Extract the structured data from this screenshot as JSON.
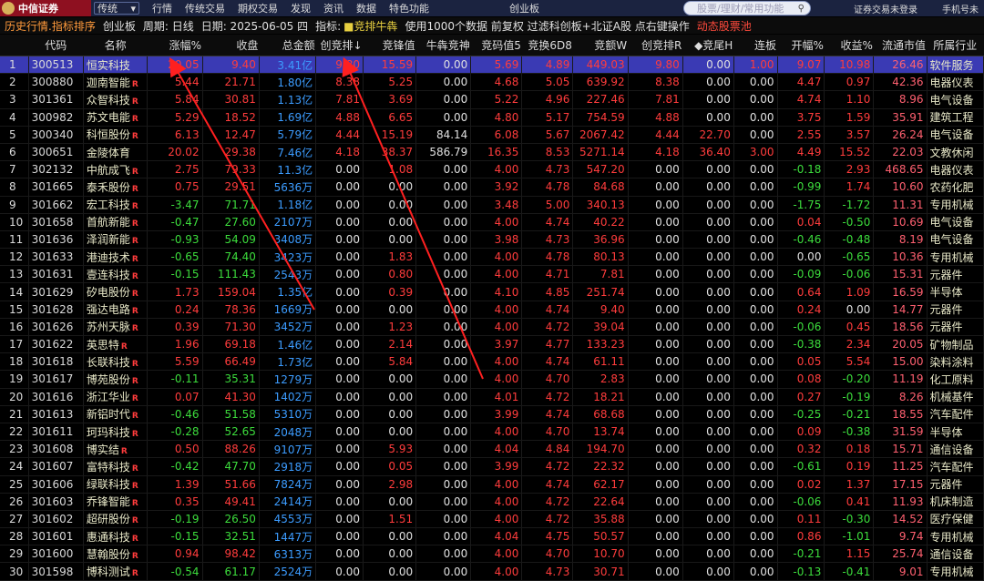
{
  "topbar": {
    "logo_text": "中信证券",
    "mode_select": "传统",
    "menu": [
      "行情",
      "传统交易",
      "期权交易",
      "发现",
      "资讯",
      "数据",
      "特色功能"
    ],
    "board_label": "创业板",
    "search_placeholder": "股票/理财/常用功能",
    "login_text": "证券交易未登录",
    "phone_text": "手机号未"
  },
  "infobar": {
    "history": "历史行情.指标排序",
    "board": "创业板",
    "period": "周期: 日线",
    "date": "日期: 2025-06-05 四",
    "indicator_label": "指标:",
    "indicator": "■竞排牛犇",
    "note": "使用1000个数据 前复权 过滤科创板+北证A股 点右键操作",
    "pool": "动态股票池"
  },
  "columns": [
    "",
    "代码",
    "名称",
    "涨幅%",
    "收盘",
    "总金额",
    "创竞排↓",
    "竞锋值",
    "牛犇竞神",
    "竞码值5",
    "竞换6D8",
    "竞额W",
    "创竞排R",
    "◆竞尾H",
    "连板",
    "开幅%",
    "收益%",
    "流通市值",
    "所属行业"
  ],
  "rows": [
    [
      "1",
      "300513",
      "恒实科技",
      "",
      "20.05",
      "9.40",
      "3.41亿",
      "9.80",
      "15.59",
      "0.00",
      "5.69",
      "4.89",
      "449.03",
      "9.80",
      "0.00",
      "1.00",
      "9.07",
      "10.98",
      "26.46",
      "软件服务"
    ],
    [
      "2",
      "300880",
      "迦南智能",
      "R",
      "5.44",
      "21.71",
      "1.80亿",
      "8.38",
      "5.25",
      "0.00",
      "4.68",
      "5.05",
      "639.92",
      "8.38",
      "0.00",
      "0.00",
      "4.47",
      "0.97",
      "42.36",
      "电器仪表"
    ],
    [
      "3",
      "301361",
      "众智科技",
      "R",
      "5.84",
      "30.81",
      "1.13亿",
      "7.81",
      "3.69",
      "0.00",
      "5.22",
      "4.96",
      "227.46",
      "7.81",
      "0.00",
      "0.00",
      "4.74",
      "1.10",
      "8.96",
      "电气设备"
    ],
    [
      "4",
      "300982",
      "苏文电能",
      "R",
      "5.29",
      "18.52",
      "1.69亿",
      "4.88",
      "6.65",
      "0.00",
      "4.80",
      "5.17",
      "754.59",
      "4.88",
      "0.00",
      "0.00",
      "3.75",
      "1.59",
      "35.91",
      "建筑工程"
    ],
    [
      "5",
      "300340",
      "科恒股份",
      "R",
      "6.13",
      "12.47",
      "5.79亿",
      "4.44",
      "15.19",
      "84.14",
      "6.08",
      "5.67",
      "2067.42",
      "4.44",
      "22.70",
      "0.00",
      "2.55",
      "3.57",
      "26.24",
      "电气设备"
    ],
    [
      "6",
      "300651",
      "金陵体育",
      "",
      "20.02",
      "29.38",
      "7.46亿",
      "4.18",
      "38.37",
      "586.79",
      "16.35",
      "8.53",
      "5271.14",
      "4.18",
      "36.40",
      "3.00",
      "4.49",
      "15.52",
      "22.03",
      "文教休闲"
    ],
    [
      "7",
      "302132",
      "中航成飞",
      "R",
      "2.75",
      "79.33",
      "11.3亿",
      "0.00",
      "1.08",
      "0.00",
      "4.00",
      "4.73",
      "547.20",
      "0.00",
      "0.00",
      "0.00",
      "-0.18",
      "2.93",
      "468.65",
      "电器仪表"
    ],
    [
      "8",
      "301665",
      "泰禾股份",
      "R",
      "0.75",
      "29.51",
      "5636万",
      "0.00",
      "0.00",
      "0.00",
      "3.92",
      "4.78",
      "84.68",
      "0.00",
      "0.00",
      "0.00",
      "-0.99",
      "1.74",
      "10.60",
      "农药化肥"
    ],
    [
      "9",
      "301662",
      "宏工科技",
      "R",
      "-3.47",
      "71.71",
      "1.18亿",
      "0.00",
      "0.00",
      "0.00",
      "3.48",
      "5.00",
      "340.13",
      "0.00",
      "0.00",
      "0.00",
      "-1.75",
      "-1.72",
      "11.31",
      "专用机械"
    ],
    [
      "10",
      "301658",
      "首航新能",
      "R",
      "-0.47",
      "27.60",
      "2107万",
      "0.00",
      "0.00",
      "0.00",
      "4.00",
      "4.74",
      "40.22",
      "0.00",
      "0.00",
      "0.00",
      "0.04",
      "-0.50",
      "10.69",
      "电气设备"
    ],
    [
      "11",
      "301636",
      "泽润新能",
      "R",
      "-0.93",
      "54.09",
      "3408万",
      "0.00",
      "0.00",
      "0.00",
      "3.98",
      "4.73",
      "36.96",
      "0.00",
      "0.00",
      "0.00",
      "-0.46",
      "-0.48",
      "8.19",
      "电气设备"
    ],
    [
      "12",
      "301633",
      "港迪技术",
      "R",
      "-0.65",
      "74.40",
      "3423万",
      "0.00",
      "1.83",
      "0.00",
      "4.00",
      "4.78",
      "80.13",
      "0.00",
      "0.00",
      "0.00",
      "0.00",
      "-0.65",
      "10.36",
      "专用机械"
    ],
    [
      "13",
      "301631",
      "壹连科技",
      "R",
      "-0.15",
      "111.43",
      "2543万",
      "0.00",
      "0.80",
      "0.00",
      "4.00",
      "4.71",
      "7.81",
      "0.00",
      "0.00",
      "0.00",
      "-0.09",
      "-0.06",
      "15.31",
      "元器件"
    ],
    [
      "14",
      "301629",
      "矽电股份",
      "R",
      "1.73",
      "159.04",
      "1.35亿",
      "0.00",
      "0.39",
      "0.00",
      "4.10",
      "4.85",
      "251.74",
      "0.00",
      "0.00",
      "0.00",
      "0.64",
      "1.09",
      "16.59",
      "半导体"
    ],
    [
      "15",
      "301628",
      "强达电路",
      "R",
      "0.24",
      "78.36",
      "1669万",
      "0.00",
      "0.00",
      "0.00",
      "4.00",
      "4.74",
      "9.40",
      "0.00",
      "0.00",
      "0.00",
      "0.24",
      "0.00",
      "14.77",
      "元器件"
    ],
    [
      "16",
      "301626",
      "苏州天脉",
      "R",
      "0.39",
      "71.30",
      "3452万",
      "0.00",
      "1.23",
      "0.00",
      "4.00",
      "4.72",
      "39.04",
      "0.00",
      "0.00",
      "0.00",
      "-0.06",
      "0.45",
      "18.56",
      "元器件"
    ],
    [
      "17",
      "301622",
      "英思特",
      "R",
      "1.96",
      "69.18",
      "1.46亿",
      "0.00",
      "2.14",
      "0.00",
      "3.97",
      "4.77",
      "133.23",
      "0.00",
      "0.00",
      "0.00",
      "-0.38",
      "2.34",
      "20.05",
      "矿物制品"
    ],
    [
      "18",
      "301618",
      "长联科技",
      "R",
      "5.59",
      "66.49",
      "1.73亿",
      "0.00",
      "5.84",
      "0.00",
      "4.00",
      "4.74",
      "61.11",
      "0.00",
      "0.00",
      "0.00",
      "0.05",
      "5.54",
      "15.00",
      "染料涂料"
    ],
    [
      "19",
      "301617",
      "博苑股份",
      "R",
      "-0.11",
      "35.31",
      "1279万",
      "0.00",
      "0.00",
      "0.00",
      "4.00",
      "4.70",
      "2.83",
      "0.00",
      "0.00",
      "0.00",
      "0.08",
      "-0.20",
      "11.19",
      "化工原料"
    ],
    [
      "20",
      "301616",
      "浙江华业",
      "R",
      "0.07",
      "41.30",
      "1402万",
      "0.00",
      "0.00",
      "0.00",
      "4.01",
      "4.72",
      "18.21",
      "0.00",
      "0.00",
      "0.00",
      "0.27",
      "-0.19",
      "8.26",
      "机械基件"
    ],
    [
      "21",
      "301613",
      "新铝时代",
      "R",
      "-0.46",
      "51.58",
      "5310万",
      "0.00",
      "0.00",
      "0.00",
      "3.99",
      "4.74",
      "68.68",
      "0.00",
      "0.00",
      "0.00",
      "-0.25",
      "-0.21",
      "18.55",
      "汽车配件"
    ],
    [
      "22",
      "301611",
      "珂玛科技",
      "R",
      "-0.28",
      "52.65",
      "2048万",
      "0.00",
      "0.00",
      "0.00",
      "4.00",
      "4.70",
      "13.74",
      "0.00",
      "0.00",
      "0.00",
      "0.09",
      "-0.38",
      "31.59",
      "半导体"
    ],
    [
      "23",
      "301608",
      "博实结",
      "R",
      "0.50",
      "88.26",
      "9107万",
      "0.00",
      "5.93",
      "0.00",
      "4.04",
      "4.84",
      "194.70",
      "0.00",
      "0.00",
      "0.00",
      "0.32",
      "0.18",
      "15.71",
      "通信设备"
    ],
    [
      "24",
      "301607",
      "富特科技",
      "R",
      "-0.42",
      "47.70",
      "2918万",
      "0.00",
      "0.05",
      "0.00",
      "3.99",
      "4.72",
      "22.32",
      "0.00",
      "0.00",
      "0.00",
      "-0.61",
      "0.19",
      "11.25",
      "汽车配件"
    ],
    [
      "25",
      "301606",
      "绿联科技",
      "R",
      "1.39",
      "51.66",
      "7824万",
      "0.00",
      "2.98",
      "0.00",
      "4.00",
      "4.74",
      "62.17",
      "0.00",
      "0.00",
      "0.00",
      "0.02",
      "1.37",
      "17.15",
      "元器件"
    ],
    [
      "26",
      "301603",
      "乔锋智能",
      "R",
      "0.35",
      "49.41",
      "2414万",
      "0.00",
      "0.00",
      "0.00",
      "4.00",
      "4.72",
      "22.64",
      "0.00",
      "0.00",
      "0.00",
      "-0.06",
      "0.41",
      "11.93",
      "机床制造"
    ],
    [
      "27",
      "301602",
      "超研股份",
      "R",
      "-0.19",
      "26.50",
      "4553万",
      "0.00",
      "1.51",
      "0.00",
      "4.00",
      "4.72",
      "35.88",
      "0.00",
      "0.00",
      "0.00",
      "0.11",
      "-0.30",
      "14.52",
      "医疗保健"
    ],
    [
      "28",
      "301601",
      "惠通科技",
      "R",
      "-0.15",
      "32.51",
      "1447万",
      "0.00",
      "0.00",
      "0.00",
      "4.04",
      "4.75",
      "50.57",
      "0.00",
      "0.00",
      "0.00",
      "0.86",
      "-1.01",
      "9.74",
      "专用机械"
    ],
    [
      "29",
      "301600",
      "慧翰股份",
      "R",
      "0.94",
      "98.42",
      "6313万",
      "0.00",
      "0.00",
      "0.00",
      "4.00",
      "4.70",
      "10.70",
      "0.00",
      "0.00",
      "0.00",
      "-0.21",
      "1.15",
      "25.74",
      "通信设备"
    ],
    [
      "30",
      "301598",
      "博科测试",
      "R",
      "-0.54",
      "61.17",
      "2524万",
      "0.00",
      "0.00",
      "0.00",
      "4.00",
      "4.73",
      "30.71",
      "0.00",
      "0.00",
      "0.00",
      "-0.13",
      "-0.41",
      "9.01",
      "专用机械"
    ]
  ],
  "colors": {
    "up": "#ff3c3c",
    "down": "#3cdc3c",
    "amount": "#3c9cff",
    "selected_row": "#3a3ab4",
    "arrow": "#ff2020"
  }
}
